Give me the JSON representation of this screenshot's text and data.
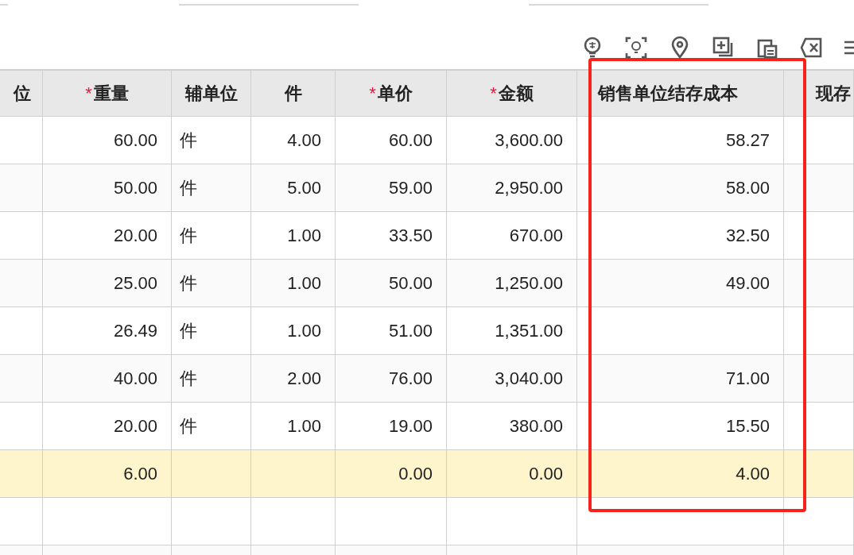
{
  "toolbar": {
    "icons": [
      {
        "kind": "stock"
      },
      {
        "kind": "scan"
      },
      {
        "kind": "pin"
      },
      {
        "kind": "add"
      },
      {
        "kind": "paste"
      },
      {
        "kind": "delete"
      },
      {
        "kind": "list"
      }
    ]
  },
  "table": {
    "columns": [
      {
        "label": "位"
      },
      {
        "label": "重量",
        "required_mark": "*"
      },
      {
        "label": "辅单位"
      },
      {
        "label": "件"
      },
      {
        "label": "单价",
        "required_mark": "*"
      },
      {
        "label": "金额",
        "required_mark": "*"
      },
      {
        "label": "销售单位结存成本"
      },
      {
        "label": "现存"
      }
    ],
    "rows": [
      {
        "highlighted": false,
        "cells": [
          "",
          "60.00",
          "件",
          "4.00",
          "60.00",
          "3,600.00",
          "58.27",
          ""
        ]
      },
      {
        "highlighted": false,
        "cells": [
          "",
          "50.00",
          "件",
          "5.00",
          "59.00",
          "2,950.00",
          "58.00",
          ""
        ]
      },
      {
        "highlighted": false,
        "cells": [
          "",
          "20.00",
          "件",
          "1.00",
          "33.50",
          "670.00",
          "32.50",
          ""
        ]
      },
      {
        "highlighted": false,
        "cells": [
          "",
          "25.00",
          "件",
          "1.00",
          "50.00",
          "1,250.00",
          "49.00",
          ""
        ]
      },
      {
        "highlighted": false,
        "cells": [
          "",
          "26.49",
          "件",
          "1.00",
          "51.00",
          "1,351.00",
          "",
          ""
        ]
      },
      {
        "highlighted": false,
        "cells": [
          "",
          "40.00",
          "件",
          "2.00",
          "76.00",
          "3,040.00",
          "71.00",
          ""
        ]
      },
      {
        "highlighted": false,
        "cells": [
          "",
          "20.00",
          "件",
          "1.00",
          "19.00",
          "380.00",
          "15.50",
          ""
        ]
      },
      {
        "highlighted": true,
        "cells": [
          "",
          "6.00",
          "",
          "",
          "0.00",
          "0.00",
          "4.00",
          ""
        ]
      },
      {
        "highlighted": false,
        "cells": [
          "",
          "",
          "",
          "",
          "",
          "",
          "",
          ""
        ]
      },
      {
        "highlighted": false,
        "cells": [
          "",
          "",
          "",
          "",
          "",
          "",
          "",
          ""
        ]
      }
    ]
  },
  "annotation": {
    "visible": true
  }
}
